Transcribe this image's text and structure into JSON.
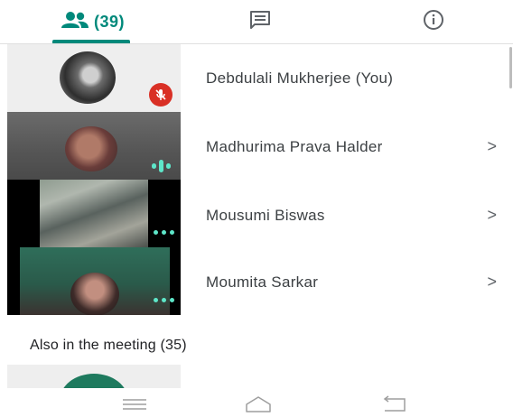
{
  "tabs": {
    "people": {
      "icon": "people-icon",
      "count_label": "(39)"
    },
    "chat": {
      "icon": "chat-icon"
    },
    "info": {
      "icon": "info-icon"
    }
  },
  "participants": [
    {
      "name": "Debdulali Mukherjee (You)",
      "status": "muted",
      "has_chevron": false
    },
    {
      "name": "Madhurima Prava Halder",
      "status": "speaking",
      "has_chevron": true
    },
    {
      "name": "Mousumi Biswas",
      "status": "dots",
      "has_chevron": true
    },
    {
      "name": "Moumita Sarkar",
      "status": "dots",
      "has_chevron": true
    }
  ],
  "also_in_meeting": {
    "label": "Also in the meeting (35)"
  },
  "navbar": {
    "icons": [
      "menu-icon",
      "home-icon",
      "back-icon"
    ]
  },
  "colors": {
    "accent": "#00897b",
    "mute_red": "#d93025",
    "audio_indicator": "#5ee6c9"
  }
}
